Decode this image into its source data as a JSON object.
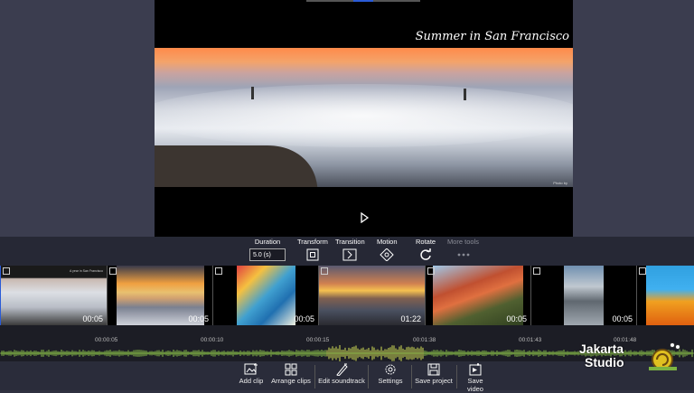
{
  "preview": {
    "caption": "Summer in San Francisco",
    "watermark": "Photo by",
    "play_icon": "play-icon"
  },
  "tools": {
    "duration": {
      "label": "Duration",
      "value": "5.0 (s)"
    },
    "transform": {
      "label": "Transform",
      "icon": "transform-icon"
    },
    "transition": {
      "label": "Transition",
      "icon": "transition-icon"
    },
    "motion": {
      "label": "Motion",
      "icon": "motion-icon"
    },
    "rotate": {
      "label": "Rotate",
      "icon": "rotate-icon"
    },
    "more": {
      "label": "More tools",
      "icon": "more-icon"
    }
  },
  "clips": [
    {
      "time": "00:05",
      "badge": "image-icon",
      "thumb_caption": "A year in San Francisco"
    },
    {
      "time": "00:05",
      "badge": "image-icon"
    },
    {
      "time": "00:05",
      "badge": "image-icon"
    },
    {
      "time": "01:22",
      "badge": "video-icon"
    },
    {
      "time": "00:05",
      "badge": "image-icon"
    },
    {
      "time": "00:05",
      "badge": "image-icon"
    },
    {
      "time": "",
      "badge": "image-icon"
    }
  ],
  "timeline": {
    "ticks": [
      "00:00:05",
      "00:00:10",
      "00:00:15",
      "00:01:38",
      "00:01:43",
      "00:01:48"
    ]
  },
  "bottom": {
    "add_clip": "Add clip",
    "arrange_clips": "Arrange clips",
    "edit_soundtrack": "Edit soundtrack",
    "settings": "Settings",
    "save_project": "Save project",
    "save_video": "Save video"
  },
  "logo": {
    "line1": "Jakarta",
    "line2": "Studio"
  },
  "colors": {
    "accent": "#2a5bd7",
    "waveform": "#8bc34a",
    "waveform_peak": "#d4e157"
  }
}
